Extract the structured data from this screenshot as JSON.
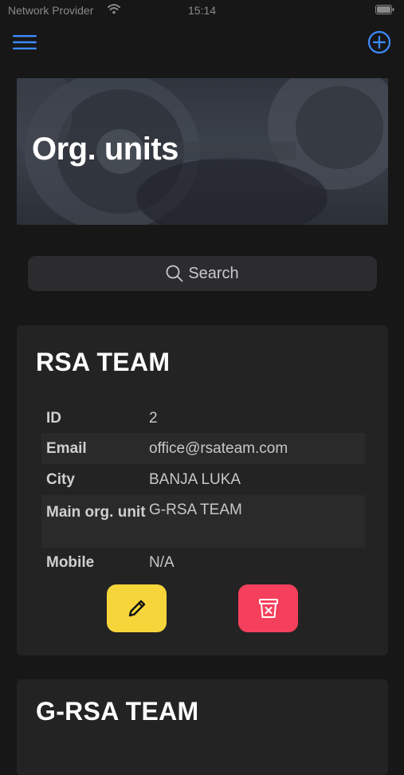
{
  "status_bar": {
    "carrier": "Network Provider",
    "time": "15:14"
  },
  "header": {
    "menu_icon": "hamburger-icon",
    "add_icon": "plus-circle-icon"
  },
  "hero": {
    "title": "Org. units"
  },
  "search": {
    "label": "Search",
    "icon": "search-icon"
  },
  "cards": [
    {
      "title": "RSA TEAM",
      "fields": {
        "id_label": "ID",
        "id_value": "2",
        "email_label": "Email",
        "email_value": "office@rsateam.com",
        "city_label": "City",
        "city_value": "BANJA LUKA",
        "main_label": "Main org. unit",
        "main_value": "G-RSA TEAM",
        "mobile_label": "Mobile",
        "mobile_value": "N/A"
      }
    },
    {
      "title": "G-RSA TEAM"
    }
  ],
  "colors": {
    "background": "#171717",
    "card": "#232324",
    "accent": "#3d8bfd",
    "edit": "#f5d53a",
    "delete": "#f4405c"
  }
}
